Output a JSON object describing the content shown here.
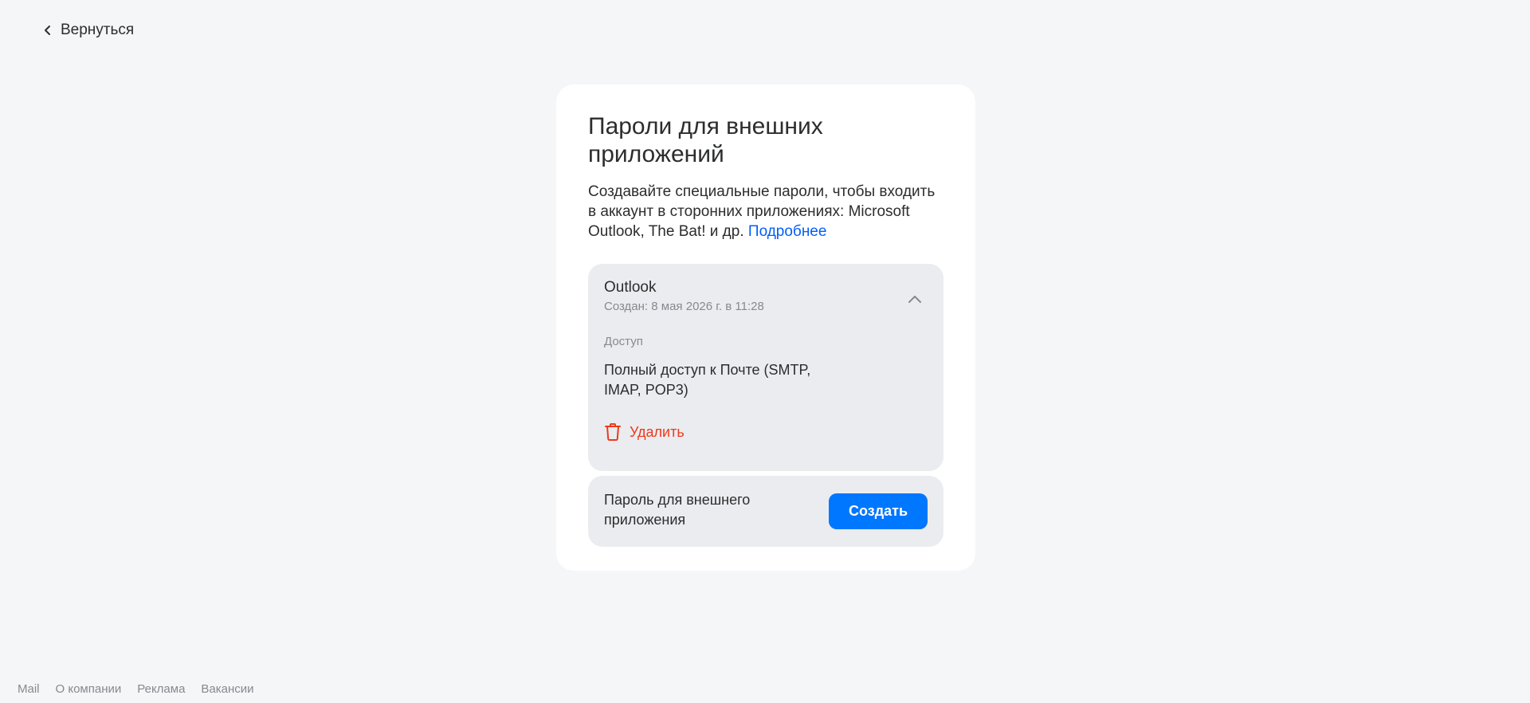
{
  "nav": {
    "back_label": "Вернуться",
    "back_icon": "chevron-left-icon"
  },
  "card": {
    "title": "Пароли для внешних приложений",
    "description": "Создавайте специальные пароли, чтобы входить в аккаунт в сторонних приложениях: Microsoft Outlook, The Bat! и др.",
    "more_link": "Подробнее"
  },
  "password_item": {
    "name": "Outlook",
    "created": "Создан: 8 мая 2026 г. в 11:28",
    "toggle_icon": "chevron-up-icon",
    "access_label": "Доступ",
    "access_value": "Полный доступ к Почте (SMTP, IMAP, POP3)",
    "delete_label": "Удалить",
    "delete_icon": "trash-icon"
  },
  "create": {
    "label": "Пароль для внешнего приложения",
    "button_label": "Создать"
  },
  "footer": {
    "links": [
      "Mail",
      "О компании",
      "Реклама",
      "Вакансии"
    ]
  },
  "colors": {
    "background": "#f5f6f8",
    "card": "#ffffff",
    "panel": "#ebecef",
    "accent": "#0077ff",
    "link": "#005ff9",
    "danger": "#ed3a1d",
    "text": "#2c2d2e",
    "secondary_text": "#87898f"
  }
}
